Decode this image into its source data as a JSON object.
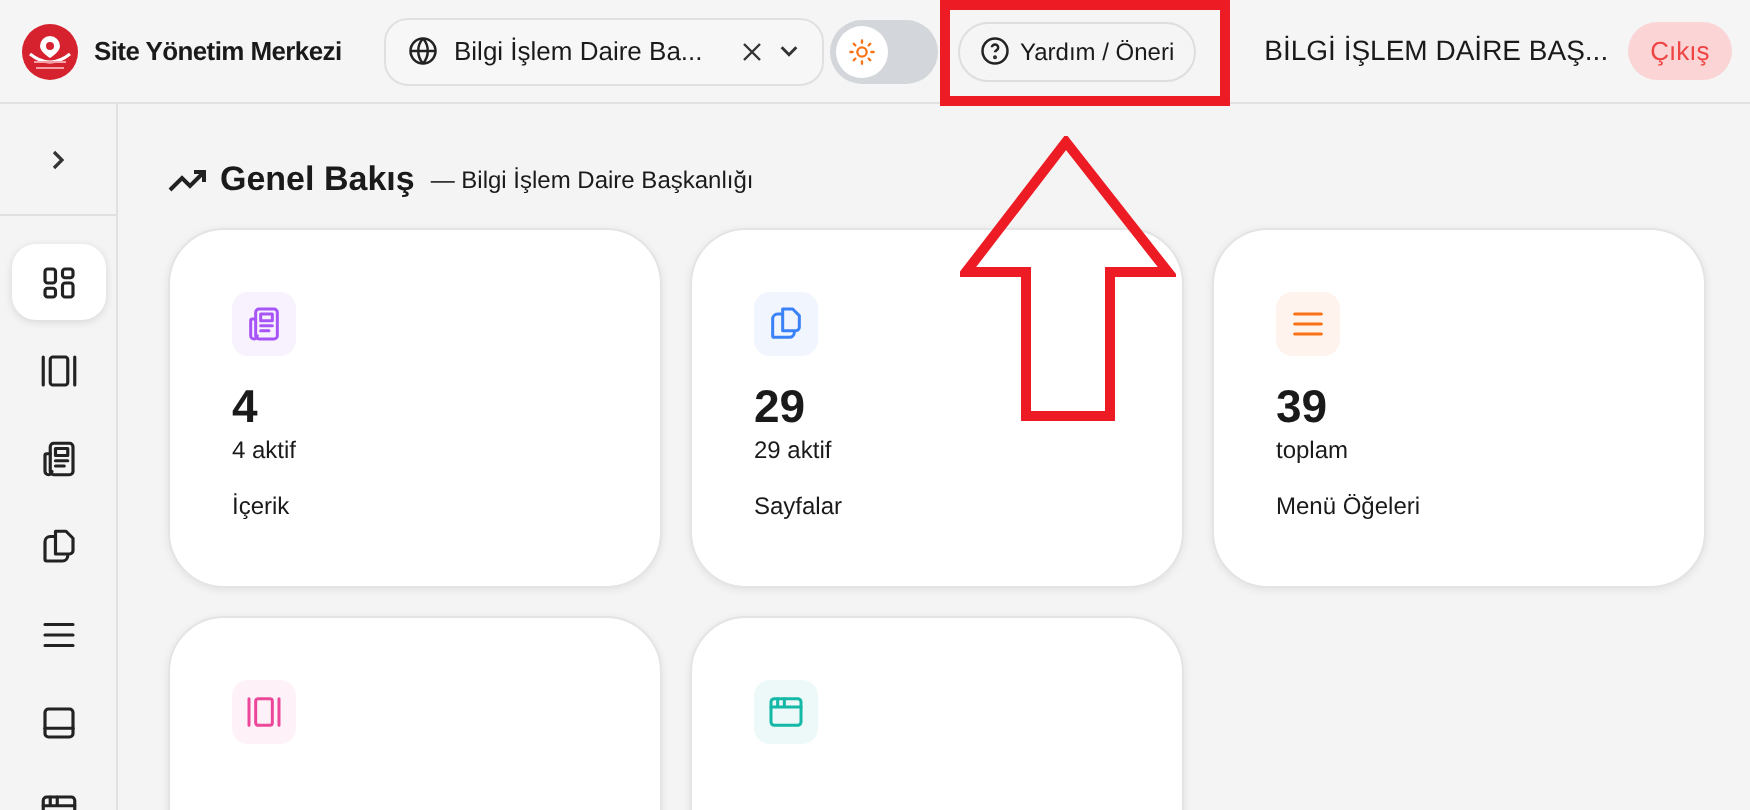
{
  "header": {
    "app_title": "Site Yönetim Merkezi",
    "org_selector": {
      "value": "Bilgi İşlem Daire Ba..."
    },
    "theme_toggle": {
      "on": false
    },
    "help_button": "Yardım / Öneri",
    "user_name": "BİLGİ İŞLEM DAİRE BAŞ...",
    "logout_button": "Çıkış"
  },
  "sidebar": {
    "items": [
      {
        "kind": "dashboard",
        "selected": true
      },
      {
        "kind": "slider",
        "selected": false
      },
      {
        "kind": "newspaper",
        "selected": false
      },
      {
        "kind": "pages",
        "selected": false
      },
      {
        "kind": "menu",
        "selected": false
      },
      {
        "kind": "panel",
        "selected": false
      },
      {
        "kind": "browser",
        "selected": false
      }
    ]
  },
  "page": {
    "title": "Genel Bakış",
    "subtitle": "— Bilgi İşlem Daire Başkanlığı"
  },
  "cards": [
    {
      "kind": "newspaper",
      "color": "#a855f7",
      "value": "4",
      "detail": "4 aktif",
      "label": "İçerik"
    },
    {
      "kind": "pages",
      "color": "#3b82f6",
      "value": "29",
      "detail": "29 aktif",
      "label": "Sayfalar"
    },
    {
      "kind": "menu",
      "color": "#f97316",
      "value": "39",
      "detail": "toplam",
      "label": "Menü Öğeleri"
    },
    {
      "kind": "slider",
      "color": "#ec4899"
    },
    {
      "kind": "browser",
      "color": "#14b8a6"
    }
  ]
}
